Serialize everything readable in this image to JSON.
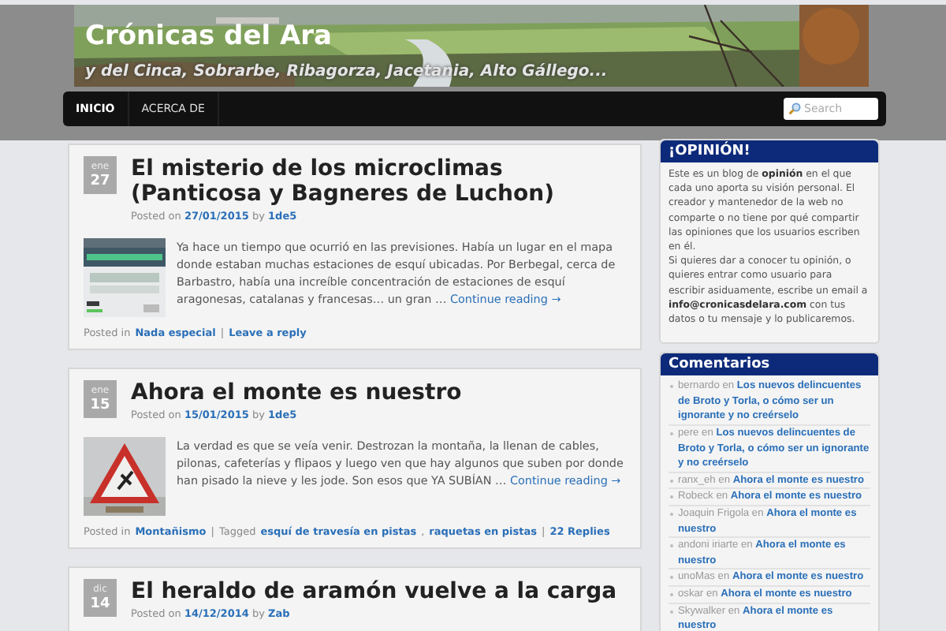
{
  "header": {
    "title": "Crónicas del Ara",
    "tagline": "y del Cinca, Sobrarbe, Ribagorza, Jacetania, Alto Gállego..."
  },
  "nav": {
    "items": [
      {
        "label": "INICIO",
        "selected": true
      },
      {
        "label": "ACERCA DE",
        "selected": false
      }
    ],
    "search": {
      "placeholder": "Search"
    }
  },
  "posts": [
    {
      "month": "ene",
      "day": "27",
      "title": "El misterio de los microclimas (Panticosa y Bagneres de Luchon)",
      "meta": {
        "posted_on": "Posted on",
        "date": "27/01/2015",
        "by": "by",
        "author": "1de5"
      },
      "excerpt": "Ya hace un tiempo que ocurrió en las previsiones. Había un lugar en el mapa donde estaban muchas estaciones de esquí ubicadas. Por Berbegal, cerca de Barbastro, había una increíble concentración de estaciones de esquí aragonesas, catalanas y francesas… un gran …",
      "more": "Continue reading →",
      "footer": [
        {
          "kind": "text",
          "text": "Posted in"
        },
        {
          "kind": "link",
          "text": "Nada especial"
        },
        {
          "kind": "sep",
          "text": "|"
        },
        {
          "kind": "link",
          "text": "Leave a reply"
        }
      ]
    },
    {
      "month": "ene",
      "day": "15",
      "title": "Ahora el monte es nuestro",
      "meta": {
        "posted_on": "Posted on",
        "date": "15/01/2015",
        "by": "by",
        "author": "1de5"
      },
      "excerpt": "La verdad es que se veía venir. Destrozan la montaña, la llenan de cables, pilonas, cafeterías y flipaos y luego ven que hay algunos que suben por donde han pisado la nieve y les jode. Son esos que YA SUBÍAN …",
      "more": "Continue reading →",
      "footer": [
        {
          "kind": "text",
          "text": "Posted in"
        },
        {
          "kind": "link",
          "text": "Montañismo"
        },
        {
          "kind": "sep",
          "text": "|"
        },
        {
          "kind": "text",
          "text": "Tagged"
        },
        {
          "kind": "link",
          "text": "esquí de travesía en pistas"
        },
        {
          "kind": "text",
          "text": ","
        },
        {
          "kind": "link",
          "text": "raquetas en pistas"
        },
        {
          "kind": "sep",
          "text": "|"
        },
        {
          "kind": "link",
          "text": "22 Replies"
        }
      ]
    },
    {
      "month": "dic",
      "day": "14",
      "title": "El heraldo de aramón vuelve a la carga",
      "meta": {
        "posted_on": "Posted on",
        "date": "14/12/2014",
        "by": "by",
        "author": "Zab"
      }
    }
  ],
  "sidebar": [
    {
      "kind": "text",
      "title": "¡OPINIÓN!",
      "paragraphs": [
        "Este es un blog de **opinión** en el que cada uno aporta su visión personal. El creador y mantenedor de la web no comparte o no tiene por qué compartir las opiniones que los usuarios escriben en él.",
        "Si quieres dar a conocer tu opinión, o quieres entrar como usuario para escribir asiduamente, escribe un email a **info@cronicasdelara.com** con tus datos o tu mensaje y lo publicaremos."
      ]
    },
    {
      "kind": "comments",
      "title": "Comentarios",
      "items": [
        {
          "author": "bernardo",
          "on": "en",
          "post": "Los nuevos delincuentes de Broto y Torla, o cómo ser un ignorante y no creérselo"
        },
        {
          "author": "pere",
          "on": "en",
          "post": "Los nuevos delincuentes de Broto y Torla, o cómo ser un ignorante y no creérselo"
        },
        {
          "author": "ranx_eh",
          "on": "en",
          "post": "Ahora el monte es nuestro"
        },
        {
          "author": "Robeck",
          "on": "en",
          "post": "Ahora el monte es nuestro"
        },
        {
          "author": "Joaquin Frigola",
          "on": "en",
          "post": "Ahora el monte es nuestro"
        },
        {
          "author": "andoni iriarte",
          "on": "en",
          "post": "Ahora el monte es nuestro"
        },
        {
          "author": "unoMas",
          "on": "en",
          "post": "Ahora el monte es nuestro"
        },
        {
          "author": "oskar",
          "on": "en",
          "post": "Ahora el monte es nuestro"
        },
        {
          "author": "Skywalker",
          "on": "en",
          "post": "Ahora el monte es nuestro"
        }
      ]
    }
  ]
}
